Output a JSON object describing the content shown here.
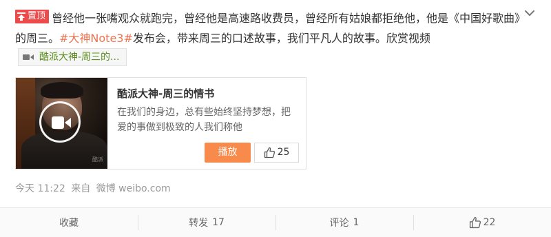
{
  "post": {
    "pin_label": "置顶",
    "text_1": "曾经他一张嘴观众就跑完，曾经他是高速路收费员，曾经所有姑娘都拒绝他，他是《中国好歌曲》的周三。",
    "topic": "#大神Note3#",
    "text_2": "发布会，带来周三的口述故事，我们平凡人的故事。欣赏视频",
    "video_link_label": "酷派大神-周三的..."
  },
  "video_card": {
    "title": "酷派大神-周三的情书",
    "description": "在我们的身边，总有些始终坚持梦想，把爱的事做到极致的人我们称他",
    "play_label": "播放",
    "like_count": "25",
    "thumb_watermark": "酷派"
  },
  "meta": {
    "time": "今天 11:22",
    "from_label": "来自",
    "source": "微博 weibo.com"
  },
  "actions": {
    "favorite_label": "收藏",
    "repost_label": "转发",
    "repost_count": "17",
    "comment_label": "评论",
    "comment_count": "1",
    "like_count": "22"
  },
  "colors": {
    "pin_badge": "#eb4b4b",
    "topic": "#eb7350",
    "video_link": "#5a8e1e",
    "play_button": "#f88a4b"
  },
  "icons": {
    "pin": "pin-icon",
    "video_link": "video-camera-icon",
    "play_overlay": "play-video-icon",
    "like": "thumbs-up-icon",
    "collapse": "chevron-down-icon"
  }
}
